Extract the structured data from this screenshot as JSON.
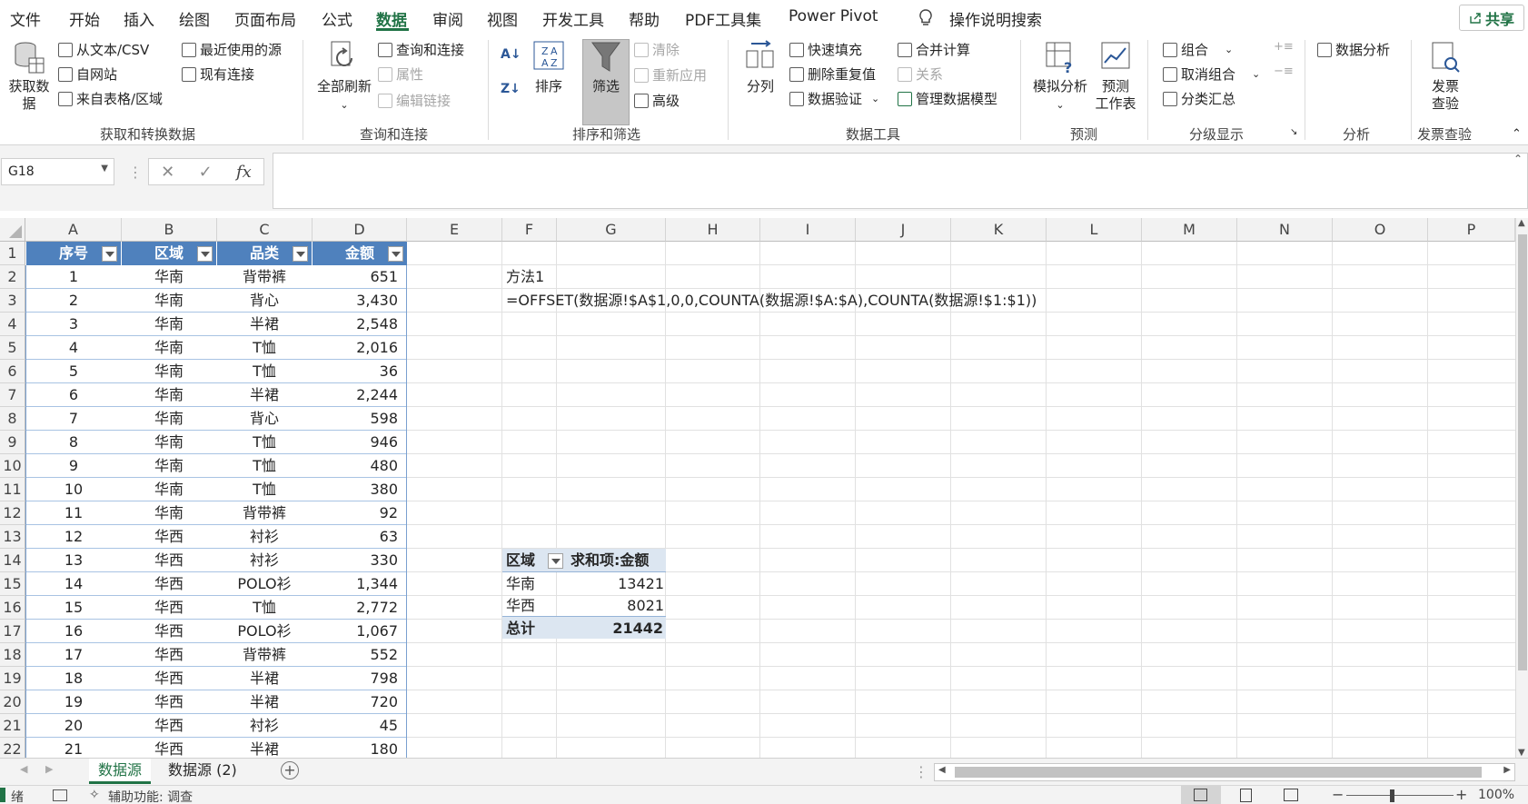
{
  "ribbon_tabs": [
    "文件",
    "开始",
    "插入",
    "绘图",
    "页面布局",
    "公式",
    "数据",
    "审阅",
    "视图",
    "开发工具",
    "帮助",
    "PDF工具集",
    "Power Pivot"
  ],
  "active_tab": "数据",
  "tell_me": "操作说明搜索",
  "share_label": "共享",
  "groups": {
    "get_transform": {
      "label": "获取和转换数据",
      "get_data": "获取数\n据",
      "from_text": "从文本/CSV",
      "from_web": "自网站",
      "from_table": "来自表格/区域",
      "recent_sources": "最近使用的源",
      "existing_conn": "现有连接"
    },
    "queries": {
      "label": "查询和连接",
      "refresh_all": "全部刷新",
      "queries_conn": "查询和连接",
      "properties": "属性",
      "edit_links": "编辑链接"
    },
    "sort_filter": {
      "label": "排序和筛选",
      "sort": "排序",
      "filter": "筛选",
      "clear": "清除",
      "reapply": "重新应用",
      "advanced": "高级"
    },
    "data_tools": {
      "label": "数据工具",
      "split": "分列",
      "flash_fill": "快速填充",
      "remove_dup": "删除重复值",
      "validation": "数据验证",
      "consolidate": "合并计算",
      "relations": "关系",
      "manage_model": "管理数据模型"
    },
    "forecast": {
      "label": "预测",
      "whatif": "模拟分析",
      "sheet": "预测\n工作表"
    },
    "outline": {
      "label": "分级显示",
      "group": "组合",
      "ungroup": "取消组合",
      "subtotal": "分类汇总"
    },
    "analysis": {
      "label": "分析",
      "data_analysis": "数据分析"
    },
    "invoice": {
      "label": "发票查验",
      "check": "发票\n查验"
    }
  },
  "name_box": "G18",
  "columns": [
    "A",
    "B",
    "C",
    "D",
    "E",
    "F",
    "G",
    "H",
    "I",
    "J",
    "K",
    "L",
    "M",
    "N",
    "O",
    "P"
  ],
  "table_headers": [
    "序号",
    "区域",
    "品类",
    "金额"
  ],
  "rows": [
    [
      "1",
      "华南",
      "背带裤",
      "651"
    ],
    [
      "2",
      "华南",
      "背心",
      "3,430"
    ],
    [
      "3",
      "华南",
      "半裙",
      "2,548"
    ],
    [
      "4",
      "华南",
      "T恤",
      "2,016"
    ],
    [
      "5",
      "华南",
      "T恤",
      "36"
    ],
    [
      "6",
      "华南",
      "半裙",
      "2,244"
    ],
    [
      "7",
      "华南",
      "背心",
      "598"
    ],
    [
      "8",
      "华南",
      "T恤",
      "946"
    ],
    [
      "9",
      "华南",
      "T恤",
      "480"
    ],
    [
      "10",
      "华南",
      "T恤",
      "380"
    ],
    [
      "11",
      "华南",
      "背带裤",
      "92"
    ],
    [
      "12",
      "华西",
      "衬衫",
      "63"
    ],
    [
      "13",
      "华西",
      "衬衫",
      "330"
    ],
    [
      "14",
      "华西",
      "POLO衫",
      "1,344"
    ],
    [
      "15",
      "华西",
      "T恤",
      "2,772"
    ],
    [
      "16",
      "华西",
      "POLO衫",
      "1,067"
    ],
    [
      "17",
      "华西",
      "背带裤",
      "552"
    ],
    [
      "18",
      "华西",
      "半裙",
      "798"
    ],
    [
      "19",
      "华西",
      "半裙",
      "720"
    ],
    [
      "20",
      "华西",
      "衬衫",
      "45"
    ],
    [
      "21",
      "华西",
      "半裙",
      "180"
    ]
  ],
  "method_label": "方法1",
  "formula_text": "=OFFSET(数据源!$A$1,0,0,COUNTA(数据源!$A:$A),COUNTA(数据源!$1:$1))",
  "pivot": {
    "header_region": "区域",
    "header_sum": "求和项:金额",
    "rows": [
      {
        "region": "华南",
        "sum": "13421"
      },
      {
        "region": "华西",
        "sum": "8021"
      }
    ],
    "total_label": "总计",
    "total_value": "21442"
  },
  "sheets": [
    "数据源",
    "数据源 (2)"
  ],
  "active_sheet": "数据源",
  "status": {
    "ready": "绪",
    "accessibility": "辅助功能: 调查",
    "zoom": "100%"
  }
}
